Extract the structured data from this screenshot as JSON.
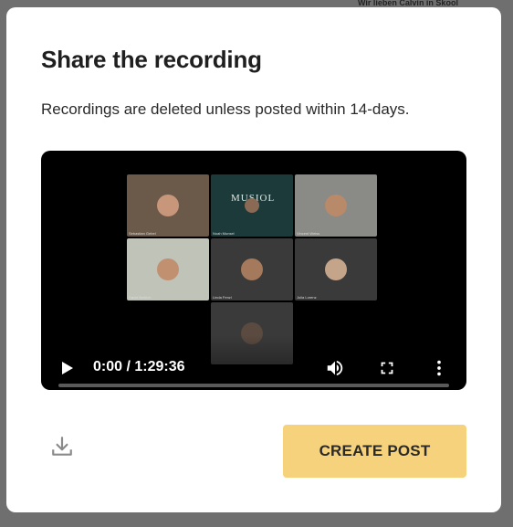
{
  "background": {
    "banner_text": "Wir lieben Calvin in Skool"
  },
  "modal": {
    "title": "Share the recording",
    "subtitle": "Recordings are deleted unless posted within 14-days."
  },
  "video": {
    "time_display": "0:00 / 1:29:36",
    "progress_fraction": 0,
    "participants": [
      {
        "name": "Sebastian Gebel",
        "tone": "#6b5a4a"
      },
      {
        "name": "Noah Munsel",
        "tone": "#1d3a3a",
        "logo": "MUSIOL"
      },
      {
        "name": "Vincent Weiss",
        "tone": "#8a8a86"
      },
      {
        "name": "David Bollrich",
        "tone": "#bfc3b8"
      },
      {
        "name": "Linda Fenzl",
        "tone": "#3b3b3b"
      },
      {
        "name": "Julia Lorenz",
        "tone": "#3b3b3b"
      },
      {
        "name": "",
        "tone": "#3b3b3b"
      }
    ],
    "controls": {
      "play_icon": "play-icon",
      "volume_icon": "volume-icon",
      "fullscreen_icon": "fullscreen-icon",
      "more_icon": "more-vertical-icon"
    }
  },
  "actions": {
    "download_icon": "download-icon",
    "create_post_label": "CREATE POST"
  },
  "colors": {
    "accent": "#f7d27c",
    "overlay": "#6f6f6f"
  }
}
